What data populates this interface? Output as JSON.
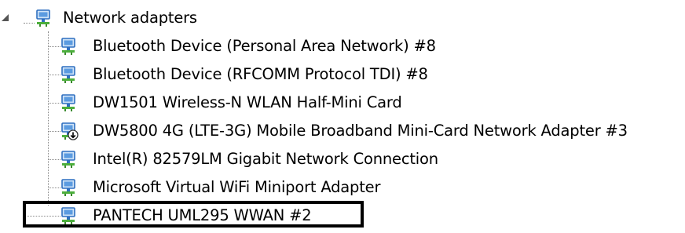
{
  "tree": {
    "category": {
      "label": "Network adapters",
      "expanded": true,
      "icon": "network-adapter-icon"
    },
    "devices": [
      {
        "label": "Bluetooth Device (Personal Area Network) #8",
        "icon": "network-adapter-icon"
      },
      {
        "label": "Bluetooth Device (RFCOMM Protocol TDI) #8",
        "icon": "network-adapter-icon"
      },
      {
        "label": "DW1501 Wireless-N WLAN Half-Mini Card",
        "icon": "network-adapter-icon"
      },
      {
        "label": "DW5800 4G (LTE-3G) Mobile Broadband Mini-Card Network Adapter #3",
        "icon": "disabled-network-adapter-icon"
      },
      {
        "label": "Intel(R) 82579LM Gigabit Network Connection",
        "icon": "network-adapter-icon"
      },
      {
        "label": "Microsoft Virtual WiFi Miniport Adapter",
        "icon": "network-adapter-icon"
      },
      {
        "label": "PANTECH UML295 WWAN #2",
        "icon": "network-adapter-icon",
        "highlighted": true
      }
    ]
  },
  "colors": {
    "icon_blue": "#2e6fc0",
    "icon_green": "#4cae3c",
    "tree_line": "#888888",
    "highlight_border": "#000000"
  }
}
